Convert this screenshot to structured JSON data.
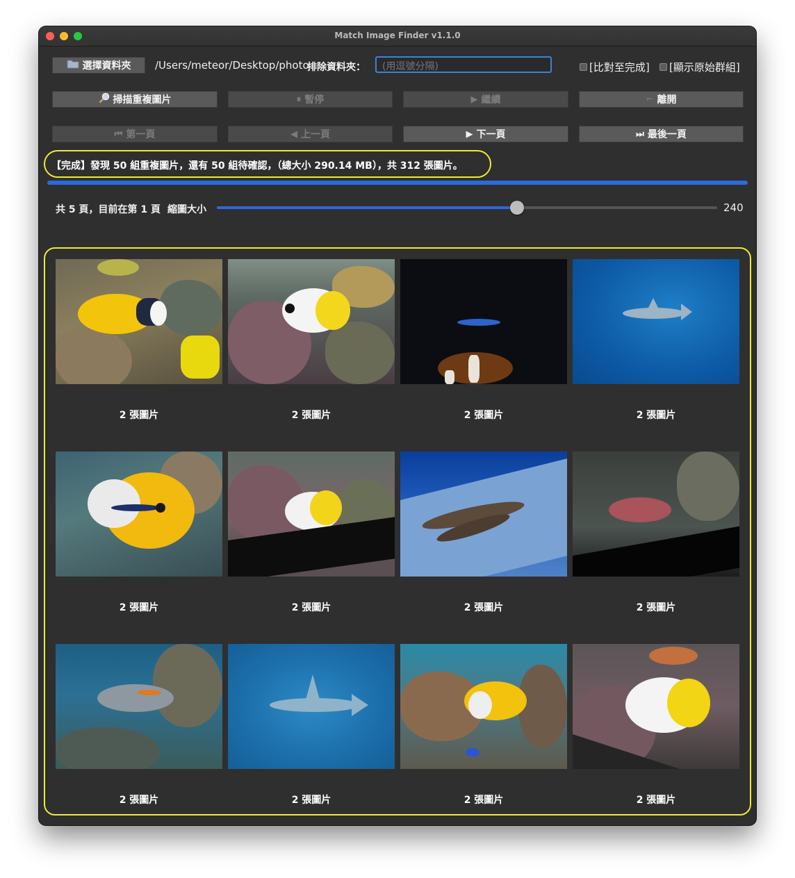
{
  "window": {
    "title": "Match Image Finder v1.1.0"
  },
  "toolbar": {
    "select_folder_label": "選擇資料夾",
    "folder_path": "/Users/meteor/Desktop/photo",
    "exclude_label": "排除資料夾：",
    "exclude_placeholder": "(用逗號分隔)",
    "compare_until_done_label": "[比對至完成]",
    "show_original_groups_label": "[顯示原始群組]"
  },
  "actions": {
    "scan_label": "掃描重複圖片",
    "pause_label": "暫停",
    "resume_label": "繼續",
    "exit_label": "離開"
  },
  "pager_buttons": {
    "first_label": "第一頁",
    "prev_label": "上一頁",
    "next_label": "下一頁",
    "last_label": "最後一頁"
  },
  "status": {
    "message": "【完成】發現 50 組重複圖片，還有 50 組待確認，（總大小 290.14 MB），共 312 張圖片。",
    "progress_percent": 100
  },
  "pager": {
    "info": "共 5 頁，目前在第 1 頁",
    "thumb_size_label": "縮圖大小",
    "thumb_size_value": "240",
    "slider_fraction": 0.6
  },
  "grid": {
    "items": [
      {
        "caption": "2 張圖片",
        "scene": "rabbitfish-yellow-on-coral"
      },
      {
        "caption": "2 張圖片",
        "scene": "butterflyfish-on-reef"
      },
      {
        "caption": "2 張圖片",
        "scene": "clownfish-dark-tank"
      },
      {
        "caption": "2 張圖片",
        "scene": "shark-blue-water"
      },
      {
        "caption": "2 張圖片",
        "scene": "rabbitfish-closeup"
      },
      {
        "caption": "2 張圖片",
        "scene": "butterflyfish-reef-tilted"
      },
      {
        "caption": "2 張圖片",
        "scene": "catsharks-blue-floor"
      },
      {
        "caption": "2 張圖片",
        "scene": "spotted-grouper-tilted"
      },
      {
        "caption": "2 張圖片",
        "scene": "surgeonfish-reef"
      },
      {
        "caption": "2 張圖片",
        "scene": "hammerhead-blue-water"
      },
      {
        "caption": "2 張圖片",
        "scene": "rabbitfish-colorful-reef"
      },
      {
        "caption": "2 張圖片",
        "scene": "butterflyfish-closeup"
      }
    ]
  }
}
